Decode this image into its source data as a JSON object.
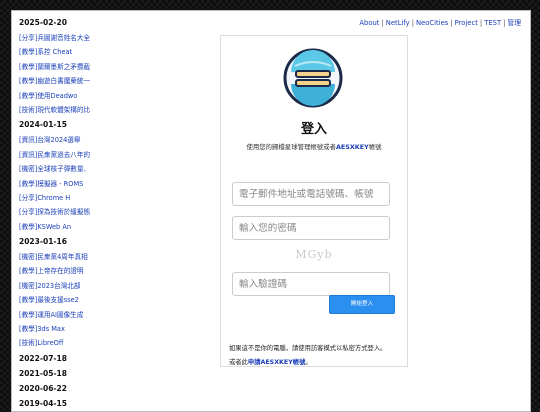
{
  "nav": {
    "items": [
      "About",
      "NetLify",
      "NeoCities",
      "Project",
      "TEST",
      "管理"
    ],
    "separator": "|"
  },
  "sidebar": {
    "groups": [
      {
        "date": "2025-02-20",
        "links": [
          "[分享]兵圖謝音姓名大全",
          "[教學]系控 Cheat",
          "[教學]蘭爾墨斯之矛攬截",
          "[教學]幽遊白書魔藥統一",
          "[教學]使用Deadwo",
          "[技術]現代軟體架構的比"
        ]
      },
      {
        "date": "2024-01-15",
        "links": [
          "[資訊]台灣2024選舉",
          "[資訊]民衆黨過去八年的",
          "[機密]全球核子彈數量、",
          "[教學]模擬器 - ROMS",
          "[分享]Chrome H",
          "[分享]探為技術於緩擬態",
          "[教學]KSWeb An"
        ]
      },
      {
        "date": "2023-01-16",
        "links": [
          "[機密]民衆黨4周年真相",
          "[教學]上帝存在的證明",
          "[機密]2023台灣北部",
          "[教學]最後支援sse2",
          "[教學]運用AI圖像生成",
          "[教學]3ds Max",
          "[技術]LibreOff"
        ]
      },
      {
        "date": "2022-07-18",
        "links": []
      },
      {
        "date": "2021-05-18",
        "links": []
      },
      {
        "date": "2020-06-22",
        "links": []
      },
      {
        "date": "2019-04-15",
        "links": []
      }
    ]
  },
  "login": {
    "title": "登入",
    "subtitle_prefix": "使用您的歸檔星球管理帳號或者",
    "subtitle_key": "AESXKEY",
    "subtitle_suffix": "帳號",
    "email_placeholder": "電子郵件地址或電話號碼、帳號",
    "password_placeholder": "輸入您的密碼",
    "captcha_text": "MGyb",
    "captcha_placeholder": "輸入驗證碼",
    "submit_label": "開始登入",
    "note_line1": "如果這不是你的電腦，請使用訪客模式以私密方式登入。",
    "note_line2_prefix": "或者此",
    "note_line2_link": "申請AESXKEY帳號",
    "note_line2_suffix": "。"
  },
  "colors": {
    "link": "#1a3fb8",
    "button": "#2b8ff0"
  },
  "icons": {
    "logo": "planet-logo-icon"
  }
}
